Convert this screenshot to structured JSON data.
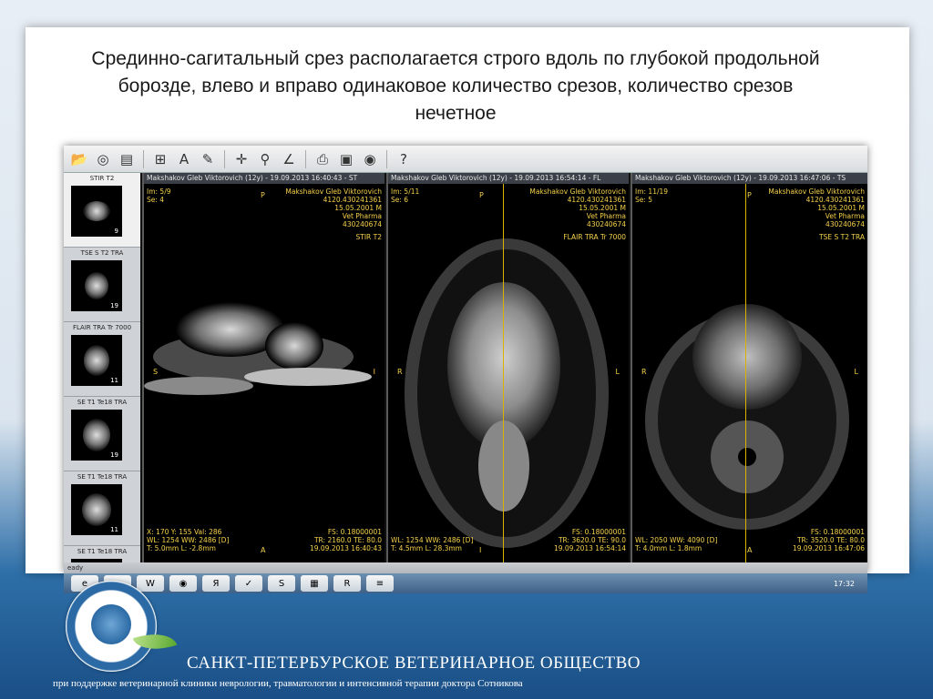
{
  "slide": {
    "title_lines": [
      "Срединно-сагитальный срез располагается строго вдоль по глубокой продольной",
      "борозде, влево и вправо одинаковое количество  срезов, количество срезов",
      "нечетное"
    ]
  },
  "toolbar": {
    "icons": [
      "open-icon",
      "cd-icon",
      "save-icon",
      "layout-icon",
      "text-icon",
      "tools-icon",
      "pan-icon",
      "measure-icon",
      "angle-icon",
      "print-icon",
      "film-icon",
      "export-icon",
      "help-icon"
    ]
  },
  "thumbnails": [
    {
      "label": "STIR T2",
      "count": "9"
    },
    {
      "label": "TSE S T2 TRA",
      "count": "19"
    },
    {
      "label": "FLAIR TRA Tr 7000",
      "count": "11"
    },
    {
      "label": "SE T1 Te18 TRA",
      "count": "19"
    },
    {
      "label": "SE T1 Te18 TRA",
      "count": "11"
    },
    {
      "label": "SE T1 Te18 TRA",
      "count": ""
    }
  ],
  "panels": [
    {
      "header": "Makshakov Gleb Viktorovich (12y) - 19.09.2013 16:40:43 - ST",
      "im": "Im: 5/9",
      "se": "Se: 4",
      "patient": "Makshakov Gleb Viktorovich",
      "id": "4120.430241361",
      "dob": "15.05.2001 M",
      "clinic": "Vet Pharma",
      "code": "430240674",
      "series": "STIR T2",
      "top": "P",
      "left": "S",
      "right": "I",
      "bottom": "A",
      "bl1": "X: 170 Y: 155 Val: 286",
      "bl2": "WL: 1254 WW: 2486 [D]",
      "bl3": "T: 5.0mm L: -2.8mm",
      "br1": "FS: 0.18000001",
      "br2": "TR: 2160.0 TE: 80.0",
      "br3": "19.09.2013 16:40:43"
    },
    {
      "header": "Makshakov Gleb Viktorovich (12y) - 19.09.2013 16:54:14 - FL",
      "im": "Im: 5/11",
      "se": "Se: 6",
      "patient": "Makshakov Gleb Viktorovich",
      "id": "4120.430241361",
      "dob": "15.05.2001 M",
      "clinic": "Vet Pharma",
      "code": "430240674",
      "series": "FLAIR TRA Tr 7000",
      "top": "P",
      "left": "R",
      "right": "L",
      "bottom": "I",
      "bl1": "",
      "bl2": "WL: 1254 WW: 2486 [D]",
      "bl3": "T: 4.5mm L: 28.3mm",
      "br1": "FS: 0.18000001",
      "br2": "TR: 3620.0 TE: 90.0",
      "br3": "19.09.2013 16:54:14"
    },
    {
      "header": "Makshakov Gleb Viktorovich (12y) - 19.09.2013 16:47:06 - TS",
      "im": "Im: 11/19",
      "se": "Se: 5",
      "patient": "Makshakov Gleb Viktorovich",
      "id": "4120.430241361",
      "dob": "15.05.2001 M",
      "clinic": "Vet Pharma",
      "code": "430240674",
      "series": "TSE S T2 TRA",
      "top": "P",
      "left": "R",
      "right": "L",
      "bottom": "A",
      "bl1": "",
      "bl2": "WL: 2050 WW: 4090 [D]",
      "bl3": "T: 4.0mm L: 1.8mm",
      "br1": "FS: 0.18000001",
      "br2": "TR: 3520.0 TE: 80.0",
      "br3": "19.09.2013 16:47:06"
    }
  ],
  "status_bar": {
    "text": "eady"
  },
  "win_taskbar": {
    "icons": [
      "explorer-icon",
      "folder-icon",
      "word-icon",
      "chrome-icon",
      "yandex-icon",
      "skype-icon",
      "antivirus-icon",
      "office-icon",
      "mri-app-icon",
      "document-icon"
    ],
    "clock": "17:32"
  },
  "footer": {
    "org_name": "САНКТ-ПЕТЕРБУРСКОЕ ВЕТЕРИНАРНОЕ ОБЩЕСТВО",
    "subtitle": "при поддержке ветеринарной клиники неврологии, травматологии и интенсивной терапии доктора Сотникова"
  }
}
